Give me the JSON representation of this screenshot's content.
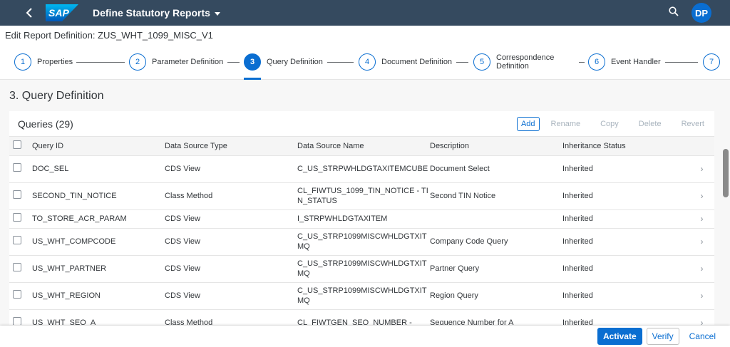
{
  "shell": {
    "logo_text": "SAP",
    "app_title": "Define Statutory Reports",
    "avatar_initials": "DP",
    "colors": {
      "shell_bg": "#354a5f",
      "accent": "#0a6ed1"
    }
  },
  "header": {
    "title": "Edit Report Definition: ZUS_WHT_1099_MISC_V1"
  },
  "wizard": {
    "steps": [
      {
        "number": "1",
        "label": "Properties"
      },
      {
        "number": "2",
        "label": "Parameter Definition"
      },
      {
        "number": "3",
        "label": "Query Definition"
      },
      {
        "number": "4",
        "label": "Document Definition"
      },
      {
        "number": "5",
        "label": "Correspondence Definition"
      },
      {
        "number": "6",
        "label": "Event Handler"
      },
      {
        "number": "7",
        "label": ""
      }
    ],
    "active_step": "3"
  },
  "section": {
    "title": "3. Query Definition"
  },
  "table": {
    "title": "Queries (29)",
    "actions": {
      "add": "Add",
      "rename": "Rename",
      "copy": "Copy",
      "delete": "Delete",
      "revert": "Revert"
    },
    "columns": [
      "Query ID",
      "Data Source Type",
      "Data Source Name",
      "Description",
      "Inheritance Status"
    ],
    "rows": [
      {
        "id": "DOC_SEL",
        "type": "CDS View",
        "source": "C_US_STRPWHLDGTAXITEMCUBE",
        "description": "Document Select",
        "status": "Inherited"
      },
      {
        "id": "SECOND_TIN_NOTICE",
        "type": "Class Method",
        "source": "CL_FIWTUS_1099_TIN_NOTICE - TIN_STATUS",
        "description": "Second TIN Notice",
        "status": "Inherited"
      },
      {
        "id": "TO_STORE_ACR_PARAM",
        "type": "CDS View",
        "source": "I_STRPWHLDGTAXITEM",
        "description": "",
        "status": "Inherited"
      },
      {
        "id": "US_WHT_COMPCODE",
        "type": "CDS View",
        "source": "C_US_STRP1099MISCWHLDGTXITMQ",
        "description": "Company Code Query",
        "status": "Inherited"
      },
      {
        "id": "US_WHT_PARTNER",
        "type": "CDS View",
        "source": "C_US_STRP1099MISCWHLDGTXITMQ",
        "description": "Partner Query",
        "status": "Inherited"
      },
      {
        "id": "US_WHT_REGION",
        "type": "CDS View",
        "source": "C_US_STRP1099MISCWHLDGTXITMQ",
        "description": "Region Query",
        "status": "Inherited"
      },
      {
        "id": "US_WHT_SEQ_A",
        "type": "Class Method",
        "source": "CL_FIWTGEN_SEQ_NUMBER -",
        "description": "Sequence Number for A",
        "status": "Inherited"
      }
    ]
  },
  "footer": {
    "activate": "Activate",
    "verify": "Verify",
    "cancel": "Cancel"
  }
}
